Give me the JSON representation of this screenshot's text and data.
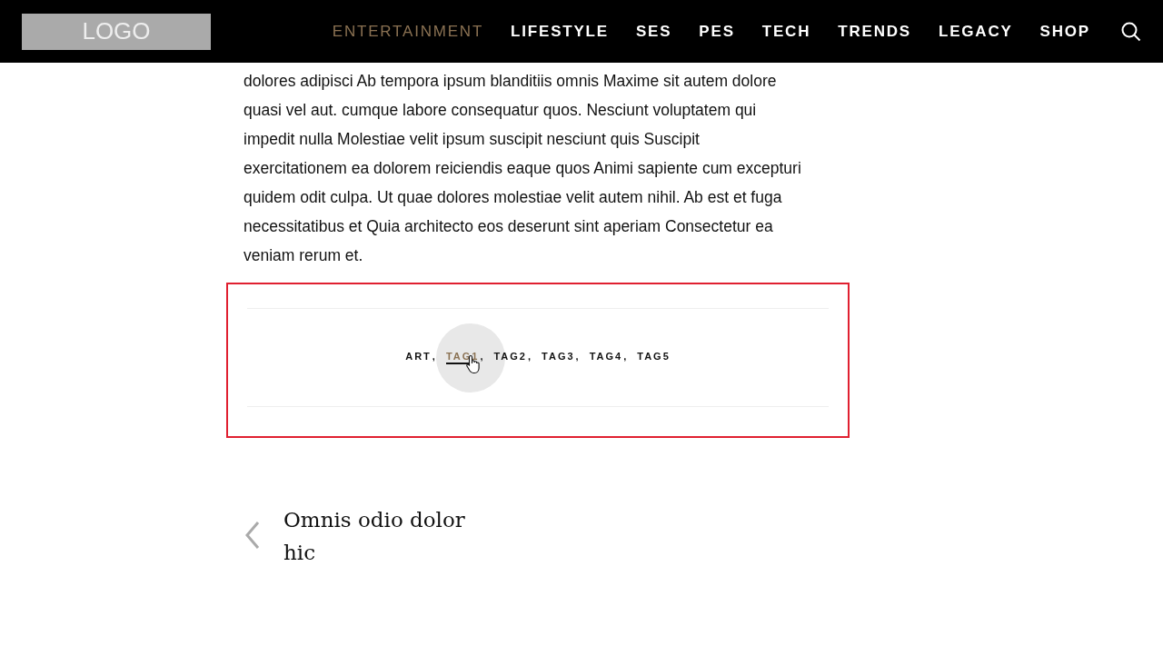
{
  "header": {
    "logo": "LOGO",
    "nav": [
      {
        "label": "ENTERTAINMENT",
        "selected": true
      },
      {
        "label": "LIFESTYLE",
        "selected": false
      },
      {
        "label": "SES",
        "selected": false
      },
      {
        "label": "PES",
        "selected": false
      },
      {
        "label": "TECH",
        "selected": false
      },
      {
        "label": "TRENDS",
        "selected": false
      },
      {
        "label": "LEGACY",
        "selected": false
      },
      {
        "label": "SHOP",
        "selected": false
      }
    ]
  },
  "article": {
    "body": "dolores adipisci Ab tempora ipsum blanditiis omnis Maxime sit autem dolore quasi vel aut. cumque labore consequatur quos. Nesciunt voluptatem qui impedit nulla Molestiae velit ipsum suscipit nesciunt quis Suscipit exercitationem ea dolorem reiciendis eaque quos Animi sapiente cum excepturi quidem odit culpa. Ut quae dolores molestiae velit autem nihil. Ab est et fuga necessitatibus et Quia architecto eos deserunt sint aperiam Consectetur ea veniam rerum et."
  },
  "tags": {
    "separator": ",",
    "items": [
      {
        "label": "ART",
        "selected": false
      },
      {
        "label": "TAG1",
        "selected": true
      },
      {
        "label": "TAG2",
        "selected": false
      },
      {
        "label": "TAG3",
        "selected": false
      },
      {
        "label": "TAG4",
        "selected": false
      },
      {
        "label": "TAG5",
        "selected": false
      }
    ]
  },
  "previous_post": {
    "title": "Omnis odio dolor hic"
  }
}
